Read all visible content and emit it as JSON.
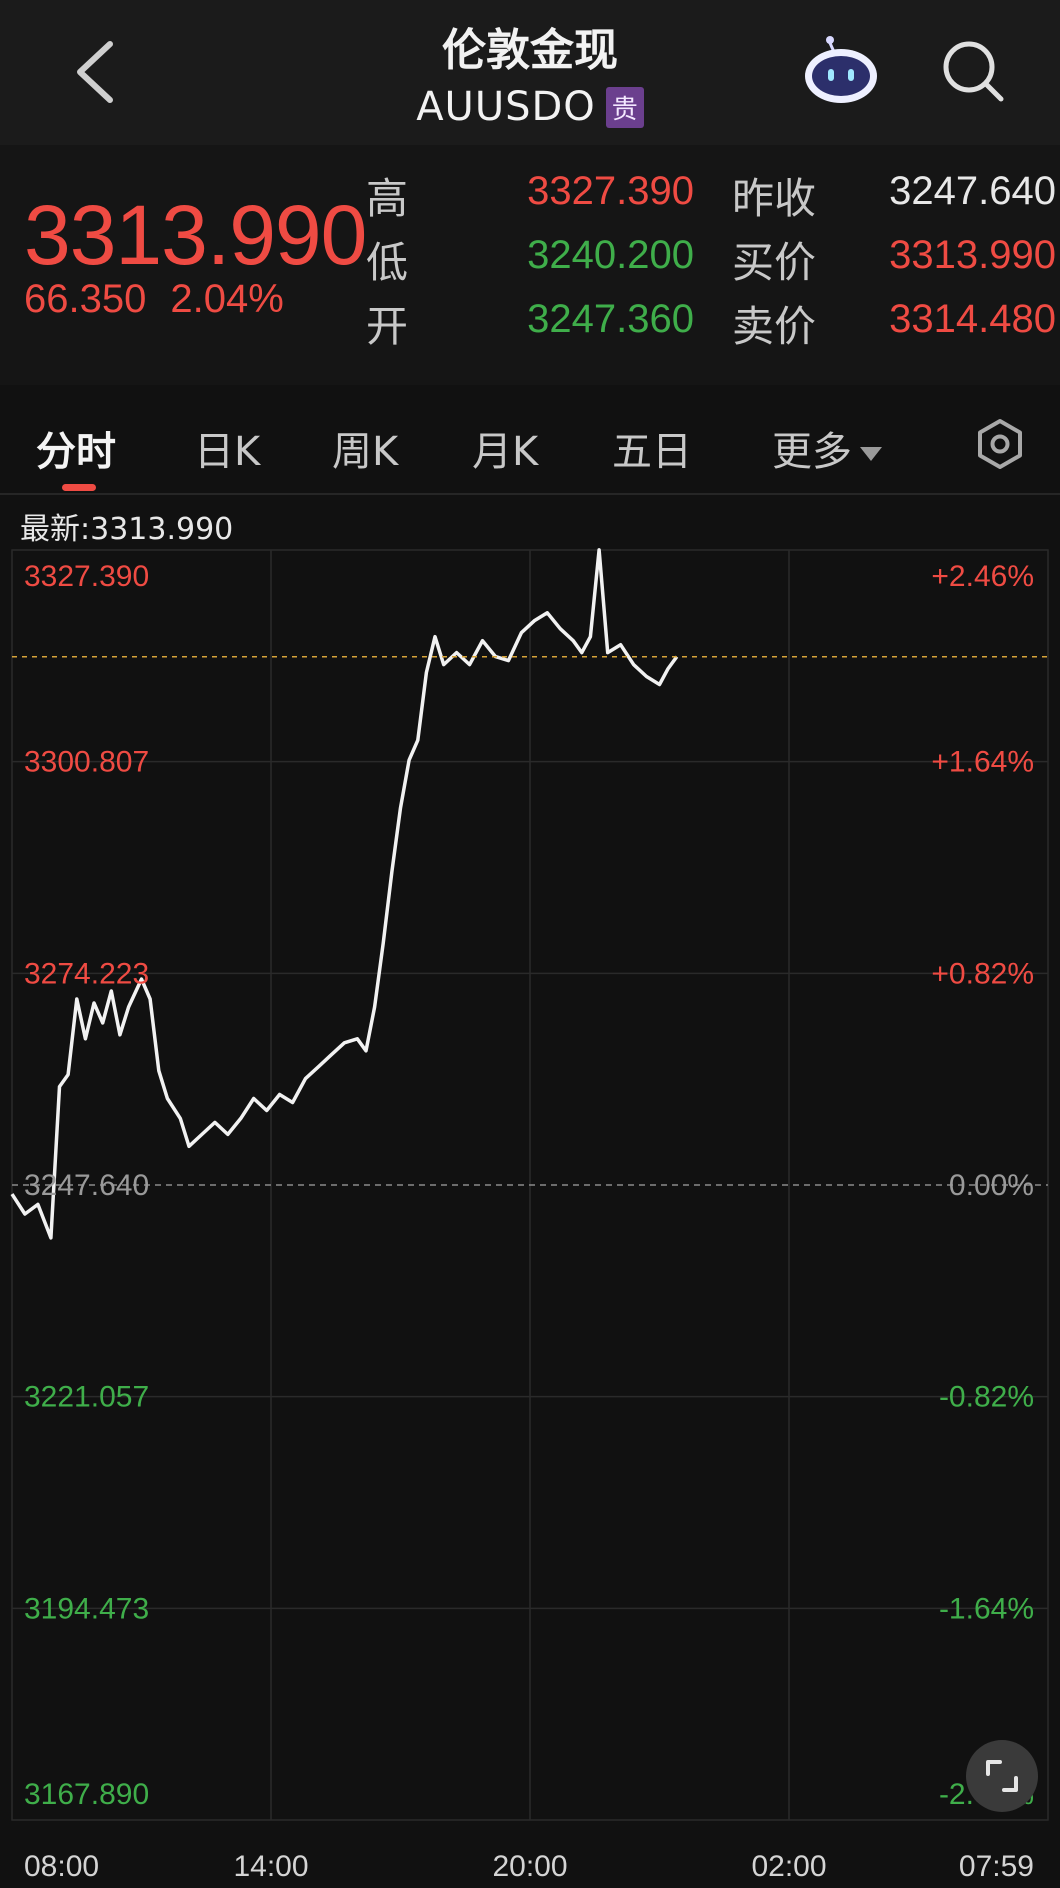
{
  "header": {
    "title": "伦敦金现",
    "code": "AUUSDO",
    "badge": "贵"
  },
  "quote": {
    "last": "3313.990",
    "change": "66.350",
    "change_pct": "2.04%",
    "rows": [
      {
        "label": "高",
        "value": "3327.390",
        "label2": "昨收",
        "value2": "3247.640"
      },
      {
        "label": "低",
        "value": "3240.200",
        "label2": "买价",
        "value2": "3313.990"
      },
      {
        "label": "开",
        "value": "3247.360",
        "label2": "卖价",
        "value2": "3314.480"
      }
    ]
  },
  "tabs": [
    "分时",
    "日K",
    "周K",
    "月K",
    "五日"
  ],
  "more_tab": "更多",
  "latest_label": "最新:3313.990",
  "chart_data": {
    "type": "line",
    "reference_price": 3247.64,
    "ylim": [
      3167.89,
      3327.39
    ],
    "y_tick_labels": [
      "3327.390",
      "3300.807",
      "3274.223",
      "3247.640",
      "3221.057",
      "3194.473",
      "3167.890"
    ],
    "y_pct_labels": [
      "+2.46%",
      "+1.64%",
      "+0.82%",
      "0.00%",
      "-0.82%",
      "-1.64%",
      "-2.46%"
    ],
    "x_tick_labels": [
      "08:00",
      "14:00",
      "20:00",
      "02:00",
      "07:59"
    ],
    "x_range_hours": [
      0,
      24
    ],
    "current_price": 3313.99,
    "series": [
      {
        "points": [
          [
            0.0,
            3246.5
          ],
          [
            0.3,
            3244.0
          ],
          [
            0.6,
            3245.2
          ],
          [
            0.9,
            3241.0
          ],
          [
            1.1,
            3260.0
          ],
          [
            1.3,
            3261.5
          ],
          [
            1.5,
            3271.0
          ],
          [
            1.7,
            3266.0
          ],
          [
            1.9,
            3270.5
          ],
          [
            2.1,
            3268.0
          ],
          [
            2.3,
            3272.0
          ],
          [
            2.5,
            3266.5
          ],
          [
            2.7,
            3270.0
          ],
          [
            3.0,
            3273.5
          ],
          [
            3.2,
            3271.0
          ],
          [
            3.4,
            3262.0
          ],
          [
            3.6,
            3258.5
          ],
          [
            3.9,
            3256.0
          ],
          [
            4.1,
            3252.5
          ],
          [
            4.4,
            3254.0
          ],
          [
            4.7,
            3255.5
          ],
          [
            5.0,
            3254.0
          ],
          [
            5.3,
            3256.0
          ],
          [
            5.6,
            3258.5
          ],
          [
            5.9,
            3257.0
          ],
          [
            6.2,
            3259.0
          ],
          [
            6.5,
            3258.0
          ],
          [
            6.8,
            3261.0
          ],
          [
            7.1,
            3262.5
          ],
          [
            7.4,
            3264.0
          ],
          [
            7.7,
            3265.5
          ],
          [
            8.0,
            3266.0
          ],
          [
            8.2,
            3264.5
          ],
          [
            8.4,
            3270.0
          ],
          [
            8.6,
            3278.0
          ],
          [
            8.8,
            3287.0
          ],
          [
            9.0,
            3295.0
          ],
          [
            9.2,
            3301.0
          ],
          [
            9.4,
            3303.5
          ],
          [
            9.6,
            3312.0
          ],
          [
            9.8,
            3316.5
          ],
          [
            10.0,
            3313.0
          ],
          [
            10.3,
            3314.5
          ],
          [
            10.6,
            3313.0
          ],
          [
            10.9,
            3316.0
          ],
          [
            11.2,
            3314.0
          ],
          [
            11.5,
            3313.5
          ],
          [
            11.8,
            3317.0
          ],
          [
            12.1,
            3318.5
          ],
          [
            12.4,
            3319.5
          ],
          [
            12.7,
            3317.5
          ],
          [
            13.0,
            3316.0
          ],
          [
            13.2,
            3314.5
          ],
          [
            13.4,
            3316.5
          ],
          [
            13.6,
            3327.4
          ],
          [
            13.8,
            3314.5
          ],
          [
            14.1,
            3315.5
          ],
          [
            14.4,
            3313.0
          ],
          [
            14.7,
            3311.5
          ],
          [
            15.0,
            3310.5
          ],
          [
            15.2,
            3312.5
          ],
          [
            15.4,
            3313.99
          ]
        ]
      }
    ]
  },
  "colors": {
    "up": "#ef4b43",
    "down": "#3fae4a",
    "line": "#f2f2f2",
    "current_line": "#d6a43a",
    "badge": "#6b3f8e"
  },
  "icons": {
    "back": "chevron-left-icon",
    "assistant": "robot-icon",
    "search": "search-icon",
    "settings": "hexagon-gear-icon",
    "expand": "expand-icon"
  }
}
